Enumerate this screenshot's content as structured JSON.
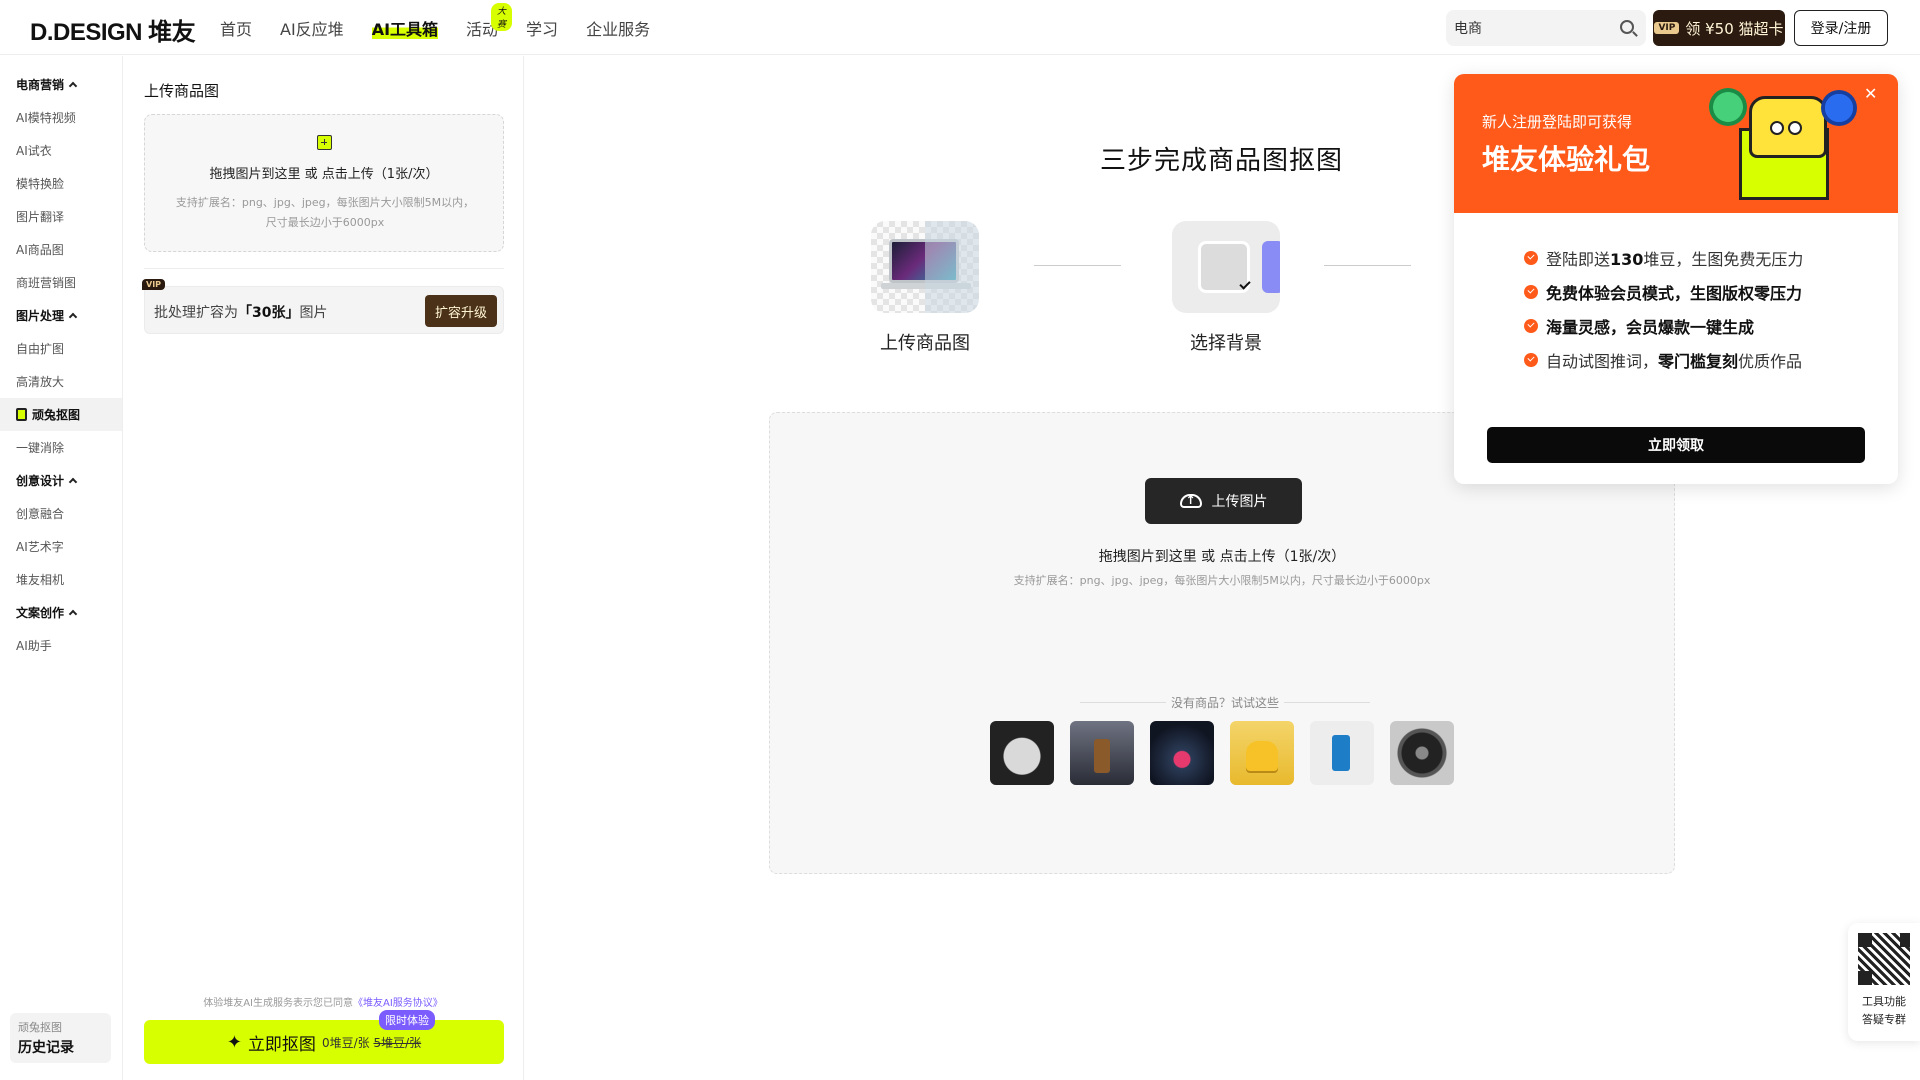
{
  "header": {
    "logo": "D.DESIGN 堆友",
    "nav": [
      {
        "label": "首页"
      },
      {
        "label": "AI反应堆"
      },
      {
        "label": "AI工具箱"
      },
      {
        "label": "活动",
        "badge": "大赛"
      },
      {
        "label": "学习"
      },
      {
        "label": "企业服务"
      }
    ],
    "search_value": "电商",
    "vip_tag": "VIP",
    "vip_label": "领 ¥50 猫超卡",
    "login_label": "登录/注册"
  },
  "sidebar": {
    "groups": [
      {
        "title": "电商营销",
        "items": [
          "AI模特视频",
          "AI试衣",
          "模特换脸",
          "图片翻译",
          "AI商品图",
          "商班营销图"
        ]
      },
      {
        "title": "图片处理",
        "items": [
          "自由扩图",
          "高清放大",
          "顽兔抠图",
          "一键消除"
        ]
      },
      {
        "title": "创意设计",
        "items": [
          "创意融合",
          "AI艺术字",
          "堆友相机"
        ]
      },
      {
        "title": "文案创作",
        "items": [
          "AI助手"
        ]
      }
    ],
    "history_top": "顽兔抠图",
    "history_label": "历史记录"
  },
  "panel": {
    "title": "上传商品图",
    "upload_main": "拖拽图片到这里 或 点击上传（1张/次）",
    "upload_sub": "支持扩展名：png、jpg、jpeg，每张图片大小限制5M以内，尺寸最长边小于6000px",
    "batch_vip": "VIP",
    "batch_prefix": "批处理扩容为",
    "batch_bold": "「30张」",
    "batch_suffix": "图片",
    "upgrade": "扩容升级",
    "agree_prefix": "体验堆友AI生成服务表示您已同意",
    "agree_link": "《堆友AI服务协议》",
    "go_label": "立即抠图",
    "go_price": "0堆豆/张",
    "go_old_price": "5堆豆/张",
    "limited": "限时体验"
  },
  "main": {
    "title": "三步完成商品图抠图",
    "steps": [
      "上传商品图",
      "选择背景"
    ],
    "upload_btn": "上传图片",
    "drop_main": "拖拽图片到这里 或 点击上传（1张/次）",
    "drop_sub": "支持扩展名：png、jpg、jpeg，每张图片大小限制5M以内，尺寸最长边小于6000px",
    "try_text": "没有商品？试试这些"
  },
  "promo": {
    "sub": "新人注册登陆即可获得",
    "title": "堆友体验礼包",
    "perks": [
      {
        "pre": "登陆即送",
        "bold": "130",
        "post": "堆豆，生图免费无压力"
      },
      {
        "pre": "",
        "bold": "免费体验会员模式，生图版权零压力",
        "post": ""
      },
      {
        "pre": "",
        "bold": "海量灵感，会员爆款一键生成",
        "post": ""
      },
      {
        "pre": "自动试图推词，",
        "bold": "零门槛复刻",
        "post": "优质作品"
      }
    ],
    "claim": "立即领取"
  },
  "qr": {
    "line1": "工具功能",
    "line2": "答疑专群"
  }
}
